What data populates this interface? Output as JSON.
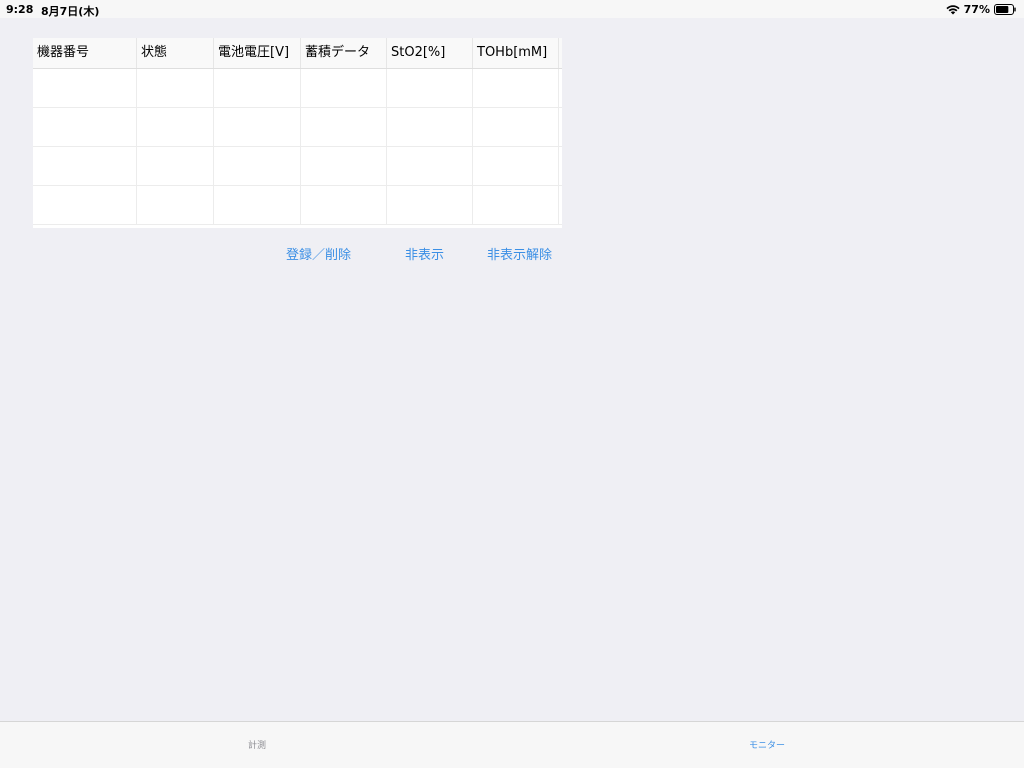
{
  "status_bar": {
    "time": "9:28",
    "date": "8月7日(木)",
    "battery_percent": "77%",
    "battery_level": 0.77
  },
  "table": {
    "headers": [
      "機器番号",
      "状態",
      "電池電圧[V]",
      "蓄積データ",
      "StO2[%]",
      "TOHb[mM]"
    ],
    "rows": [
      [
        "",
        "",
        "",
        "",
        "",
        ""
      ],
      [
        "",
        "",
        "",
        "",
        "",
        ""
      ],
      [
        "",
        "",
        "",
        "",
        "",
        ""
      ],
      [
        "",
        "",
        "",
        "",
        "",
        ""
      ]
    ]
  },
  "actions": {
    "register_delete": "登録／削除",
    "hide": "非表示",
    "unhide": "非表示解除"
  },
  "tabs": {
    "measure": "計測",
    "monitor": "モニター",
    "active": "monitor"
  },
  "colors": {
    "accent": "#3b8fe5",
    "background": "#efeff4",
    "inactive_tab": "#8e8e93"
  }
}
